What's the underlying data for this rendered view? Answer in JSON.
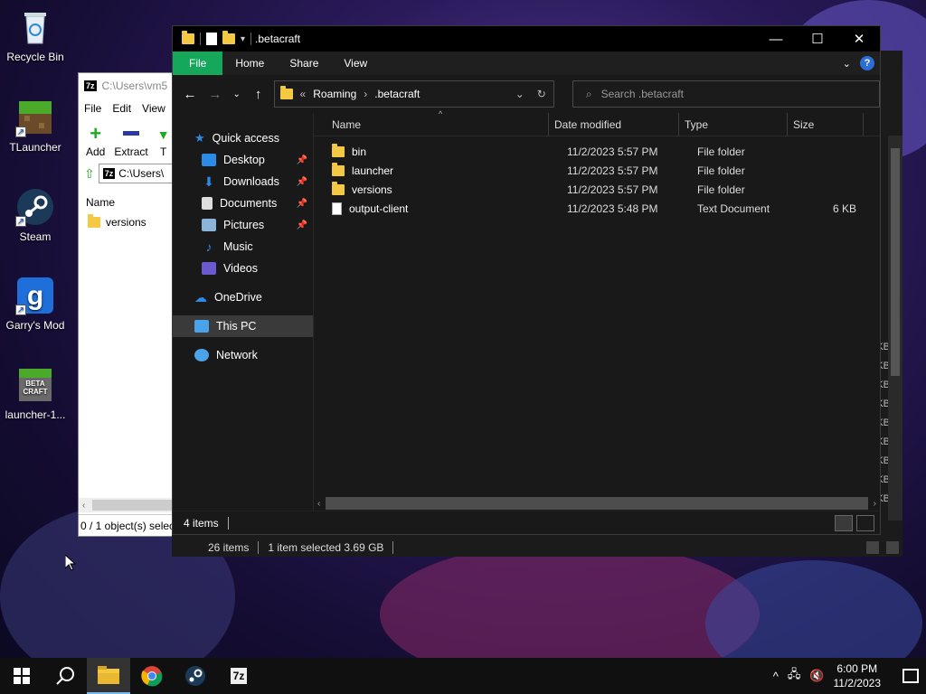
{
  "desktop": {
    "icons": [
      {
        "label": "Recycle Bin",
        "icon": "recycle-bin-icon"
      },
      {
        "label": "TLauncher",
        "icon": "tlauncher-icon"
      },
      {
        "label": "Steam",
        "icon": "steam-icon"
      },
      {
        "label": "Garry's Mod",
        "icon": "garrys-mod-icon"
      },
      {
        "label": "launcher-1...",
        "icon": "betacraft-icon",
        "badge": "BETA CRAFT"
      }
    ]
  },
  "sevenzip": {
    "title": "C:\\Users\\vm5",
    "logo": "7z",
    "menu": [
      "File",
      "Edit",
      "View"
    ],
    "tools": {
      "add": "Add",
      "extract": "Extract",
      "test": "T"
    },
    "path": "C:\\Users\\",
    "col_name": "Name",
    "row": "versions",
    "status": "0 / 1 object(s) selec"
  },
  "bg_explorer": {
    "status_items": "26 items",
    "status_selected": "1 item selected  3.69 GB",
    "kb_label": "KB"
  },
  "explorer": {
    "title": ".betacraft",
    "window_controls": {
      "minimize": "—",
      "maximize": "☐",
      "close": "✕"
    },
    "ribbon_tabs": [
      "File",
      "Home",
      "Share",
      "View"
    ],
    "help": "?",
    "breadcrumb": {
      "prefix": "«",
      "parent": "Roaming",
      "sep": "›",
      "current": ".betacraft"
    },
    "search_placeholder": "Search .betacraft",
    "sidebar": {
      "quick_access": "Quick access",
      "items": [
        {
          "label": "Desktop",
          "icon": "desktop-icon",
          "pinned": true
        },
        {
          "label": "Downloads",
          "icon": "downloads-icon",
          "pinned": true
        },
        {
          "label": "Documents",
          "icon": "documents-icon",
          "pinned": true
        },
        {
          "label": "Pictures",
          "icon": "pictures-icon",
          "pinned": true
        },
        {
          "label": "Music",
          "icon": "music-icon",
          "pinned": false
        },
        {
          "label": "Videos",
          "icon": "videos-icon",
          "pinned": false
        }
      ],
      "onedrive": "OneDrive",
      "this_pc": "This PC",
      "network": "Network"
    },
    "columns": {
      "name": "Name",
      "date": "Date modified",
      "type": "Type",
      "size": "Size"
    },
    "files": [
      {
        "name": "bin",
        "date": "11/2/2023 5:57 PM",
        "type": "File folder",
        "size": "",
        "kind": "folder"
      },
      {
        "name": "launcher",
        "date": "11/2/2023 5:57 PM",
        "type": "File folder",
        "size": "",
        "kind": "folder"
      },
      {
        "name": "versions",
        "date": "11/2/2023 5:57 PM",
        "type": "File folder",
        "size": "",
        "kind": "folder"
      },
      {
        "name": "output-client",
        "date": "11/2/2023 5:48 PM",
        "type": "Text Document",
        "size": "6 KB",
        "kind": "doc"
      }
    ],
    "status": "4 items"
  },
  "taskbar": {
    "time": "6:00 PM",
    "date": "11/2/2023",
    "apps": [
      "start-icon",
      "search-icon",
      "file-explorer-icon",
      "chrome-icon",
      "steam-icon",
      "7zip-icon"
    ],
    "seven_zip_label": "7z"
  },
  "colors": {
    "accent_file_tab": "#15a85b",
    "folder": "#f4c842",
    "selection": "#3a3a3a"
  }
}
